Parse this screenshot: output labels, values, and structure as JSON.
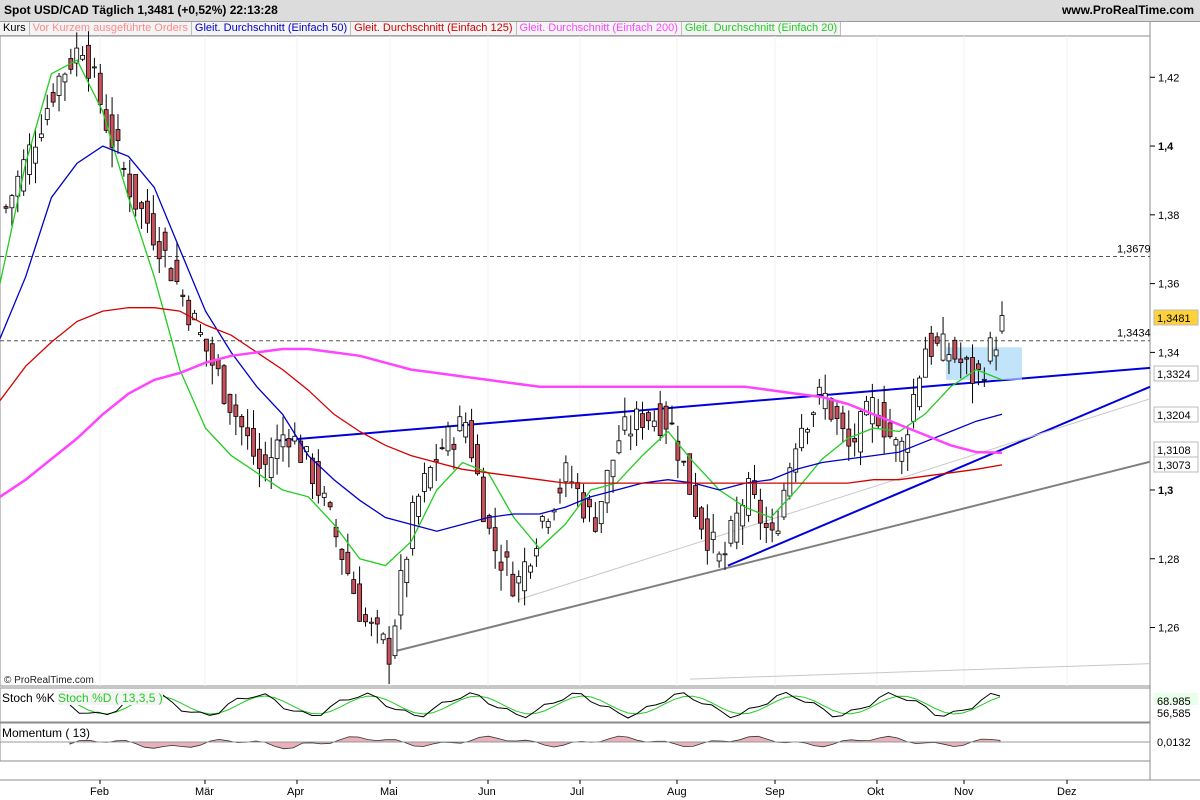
{
  "header": {
    "title": "Spot USD/CAD   Täglich   1,3481 (+0,52%)   22:13:28",
    "brand": "www.ProRealTime.com"
  },
  "legend": {
    "items": [
      {
        "label": "Kurs",
        "color": "#000000"
      },
      {
        "label": "Vor Kurzem ausgeführte Orders",
        "color": "#ff8a8a"
      },
      {
        "label": "Gleit. Durchschnitt (Einfach 50)",
        "color": "#0000c8"
      },
      {
        "label": "Gleit. Durchschnitt (Einfach 125)",
        "color": "#d40000"
      },
      {
        "label": "Gleit. Durchschnitt (Einfach 200)",
        "color": "#ff44ff"
      },
      {
        "label": "Gleit. Durchschnitt (Einfach 20)",
        "color": "#22cc22"
      }
    ]
  },
  "copyright": "© ProRealTime.com",
  "chart_data": {
    "type": "candlestick",
    "instrument": "Spot USD/CAD",
    "timeframe": "Täglich",
    "ylim": [
      1.243,
      1.432
    ],
    "y_ticks": [
      "1,42",
      "1,4",
      "1,38",
      "1,36",
      "1,34",
      "1,3",
      "1,28",
      "1,26"
    ],
    "y_ticks_bold": [
      "1,4",
      "1,3"
    ],
    "x_ticks": [
      "Feb",
      "Mär",
      "Apr",
      "Mai",
      "Jun",
      "Jul",
      "Aug",
      "Sep",
      "Okt",
      "Nov",
      "Dez"
    ],
    "reference_lines": [
      {
        "label": "1,3679",
        "value": 1.3679
      },
      {
        "label": "1,3434",
        "value": 1.3434
      }
    ],
    "price_markers": [
      {
        "label": "1,3481",
        "value": 1.3481,
        "bg": "#ffd23a",
        "fg": "#000000"
      },
      {
        "label": "1,3324",
        "value": 1.3324,
        "bg": "#ffffff",
        "fg": "#00a000"
      },
      {
        "label": "1,3204",
        "value": 1.3204,
        "bg": "#ffffff",
        "fg": "#0000c8"
      },
      {
        "label": "1,3108",
        "value": 1.3108,
        "bg": "#ffffff",
        "fg": "#ff00ff"
      },
      {
        "label": "1,3073",
        "value": 1.3073,
        "bg": "#ffffff",
        "fg": "#d40000"
      }
    ],
    "close_path": [
      [
        "Jan",
        1.382
      ],
      [
        "Jan",
        1.4
      ],
      [
        "Jan",
        1.419
      ],
      [
        "Feb",
        1.43
      ],
      [
        "Feb",
        1.405
      ],
      [
        "Feb",
        1.385
      ],
      [
        "Feb",
        1.372
      ],
      [
        "Mär",
        1.355
      ],
      [
        "Mär",
        1.338
      ],
      [
        "Mär",
        1.322
      ],
      [
        "Apr",
        1.305
      ],
      [
        "Apr",
        1.318
      ],
      [
        "Apr",
        1.305
      ],
      [
        "Apr",
        1.285
      ],
      [
        "Mai",
        1.262
      ],
      [
        "Mai",
        1.253
      ],
      [
        "Mai",
        1.295
      ],
      [
        "Mai",
        1.312
      ],
      [
        "Jun",
        1.32
      ],
      [
        "Jun",
        1.285
      ],
      [
        "Jun",
        1.272
      ],
      [
        "Jun",
        1.292
      ],
      [
        "Jul",
        1.305
      ],
      [
        "Jul",
        1.29
      ],
      [
        "Jul",
        1.315
      ],
      [
        "Jul",
        1.322
      ],
      [
        "Aug",
        1.32
      ],
      [
        "Aug",
        1.295
      ],
      [
        "Aug",
        1.278
      ],
      [
        "Sep",
        1.3
      ],
      [
        "Sep",
        1.285
      ],
      [
        "Sep",
        1.318
      ],
      [
        "Sep",
        1.328
      ],
      [
        "Okt",
        1.312
      ],
      [
        "Okt",
        1.325
      ],
      [
        "Okt",
        1.31
      ],
      [
        "Okt",
        1.342
      ],
      [
        "Nov",
        1.34
      ],
      [
        "Nov",
        1.332
      ],
      [
        "Nov",
        1.348
      ]
    ],
    "moving_averages": [
      {
        "name": "Gleit. Durchschnitt (Einfach 20)",
        "color": "#22cc22",
        "values": [
          1.36,
          1.395,
          1.421,
          1.425,
          1.41,
          1.385,
          1.362,
          1.335,
          1.318,
          1.31,
          1.305,
          1.3,
          1.298,
          1.29,
          1.28,
          1.278,
          1.285,
          1.3,
          1.308,
          1.305,
          1.292,
          1.283,
          1.29,
          1.3,
          1.302,
          1.31,
          1.317,
          1.308,
          1.3,
          1.295,
          1.292,
          1.3,
          1.309,
          1.315,
          1.318,
          1.317,
          1.322,
          1.33,
          1.335,
          1.332
        ]
      },
      {
        "name": "Gleit. Durchschnitt (Einfach 50)",
        "color": "#0000c8",
        "values": [
          1.344,
          1.362,
          1.385,
          1.395,
          1.4,
          1.397,
          1.388,
          1.37,
          1.352,
          1.34,
          1.33,
          1.322,
          1.31,
          1.303,
          1.297,
          1.292,
          1.29,
          1.288,
          1.29,
          1.292,
          1.293,
          1.293,
          1.295,
          1.298,
          1.3,
          1.302,
          1.303,
          1.302,
          1.3,
          1.302,
          1.303,
          1.306,
          1.308,
          1.309,
          1.31,
          1.311,
          1.314,
          1.317,
          1.32,
          1.322
        ]
      },
      {
        "name": "Gleit. Durchschnitt (Einfach 125)",
        "color": "#d40000",
        "values": [
          1.326,
          1.336,
          1.343,
          1.349,
          1.352,
          1.353,
          1.353,
          1.352,
          1.348,
          1.345,
          1.34,
          1.335,
          1.329,
          1.322,
          1.317,
          1.313,
          1.31,
          1.308,
          1.306,
          1.305,
          1.304,
          1.303,
          1.302,
          1.302,
          1.302,
          1.302,
          1.302,
          1.302,
          1.302,
          1.302,
          1.302,
          1.302,
          1.302,
          1.302,
          1.303,
          1.303,
          1.304,
          1.305,
          1.306,
          1.3073
        ]
      },
      {
        "name": "Gleit. Durchschnitt (Einfach 200)",
        "color": "#ff44ff",
        "values": [
          1.298,
          1.303,
          1.309,
          1.315,
          1.322,
          1.328,
          1.332,
          1.334,
          1.337,
          1.339,
          1.34,
          1.341,
          1.341,
          1.34,
          1.339,
          1.337,
          1.335,
          1.334,
          1.333,
          1.332,
          1.331,
          1.33,
          1.33,
          1.33,
          1.33,
          1.33,
          1.33,
          1.33,
          1.33,
          1.33,
          1.329,
          1.328,
          1.327,
          1.325,
          1.322,
          1.319,
          1.316,
          1.313,
          1.311,
          1.3108
        ]
      }
    ],
    "trendlines": [
      {
        "color": "#0000dd",
        "width": 2,
        "from": [
          0.24,
          1.3143
        ],
        "to": [
          1.0,
          1.3355
        ]
      },
      {
        "color": "#0000dd",
        "width": 2,
        "from": [
          0.633,
          1.278
        ],
        "to": [
          1.0,
          1.33
        ]
      },
      {
        "color": "#7f7f7f",
        "width": 2,
        "from": [
          0.342,
          1.253
        ],
        "to": [
          1.0,
          1.3082
        ]
      },
      {
        "color": "#c8c8c8",
        "width": 1,
        "from": [
          0.45,
          1.268
        ],
        "to": [
          1.0,
          1.3265
        ]
      },
      {
        "color": "#c8c8c8",
        "width": 1,
        "from": [
          0.6,
          1.245
        ],
        "to": [
          1.0,
          1.2495
        ]
      }
    ],
    "panels": [
      {
        "name": "Stoch %K",
        "series": [
          "Stoch %K",
          "Stoch %D ( 13,3,5 )"
        ],
        "value_labels": [
          "68,985",
          "56,585"
        ]
      },
      {
        "name": "Momentum ( 13)",
        "value_labels": [
          "0,0132"
        ]
      }
    ]
  }
}
